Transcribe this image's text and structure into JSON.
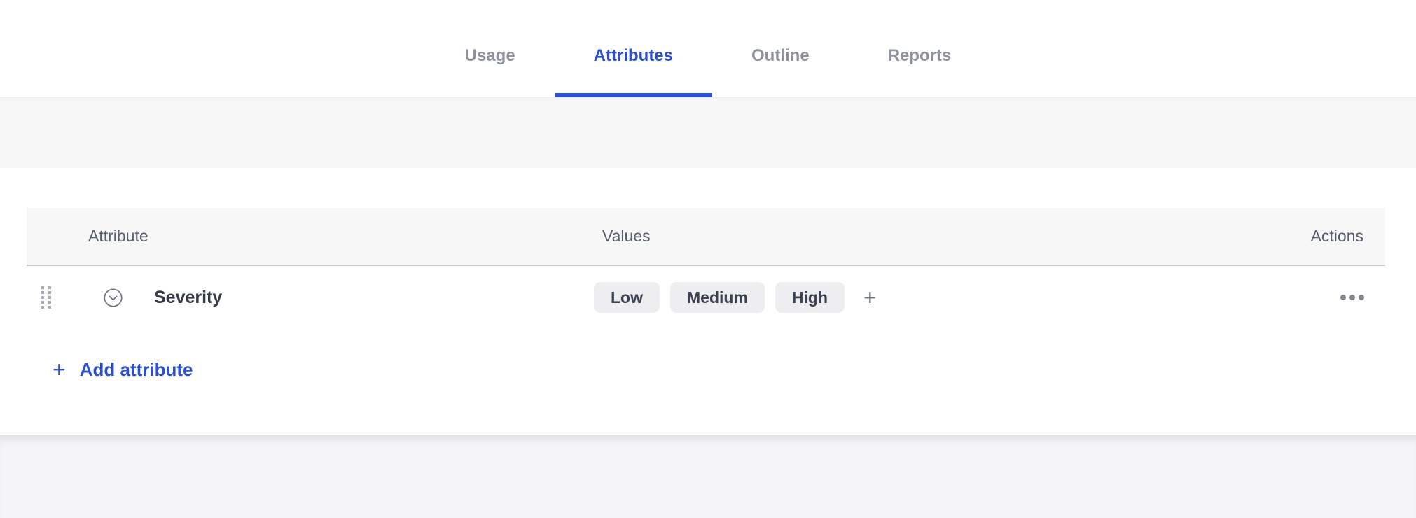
{
  "tabs": [
    {
      "id": "usage",
      "label": "Usage",
      "active": false
    },
    {
      "id": "attributes",
      "label": "Attributes",
      "active": true
    },
    {
      "id": "outline",
      "label": "Outline",
      "active": false
    },
    {
      "id": "reports",
      "label": "Reports",
      "active": false
    }
  ],
  "table": {
    "headers": {
      "attribute": "Attribute",
      "values": "Values",
      "actions": "Actions"
    },
    "rows": [
      {
        "attribute": "Severity",
        "values": [
          "Low",
          "Medium",
          "High"
        ],
        "add_value_icon": "plus-icon",
        "row_menu_icon": "ellipsis-icon",
        "drag_icon": "drag-handle-icon",
        "expand_icon": "chevron-down-circle-icon"
      }
    ]
  },
  "actions": {
    "add_attribute_label": "Add attribute",
    "add_attribute_icon": "plus-icon"
  },
  "colors": {
    "accent_blue": "#2b4fd1",
    "inactive_tab_gray": "#8d929e",
    "chip_background": "#eeeef0",
    "band_gray": "#f7f7f8"
  }
}
